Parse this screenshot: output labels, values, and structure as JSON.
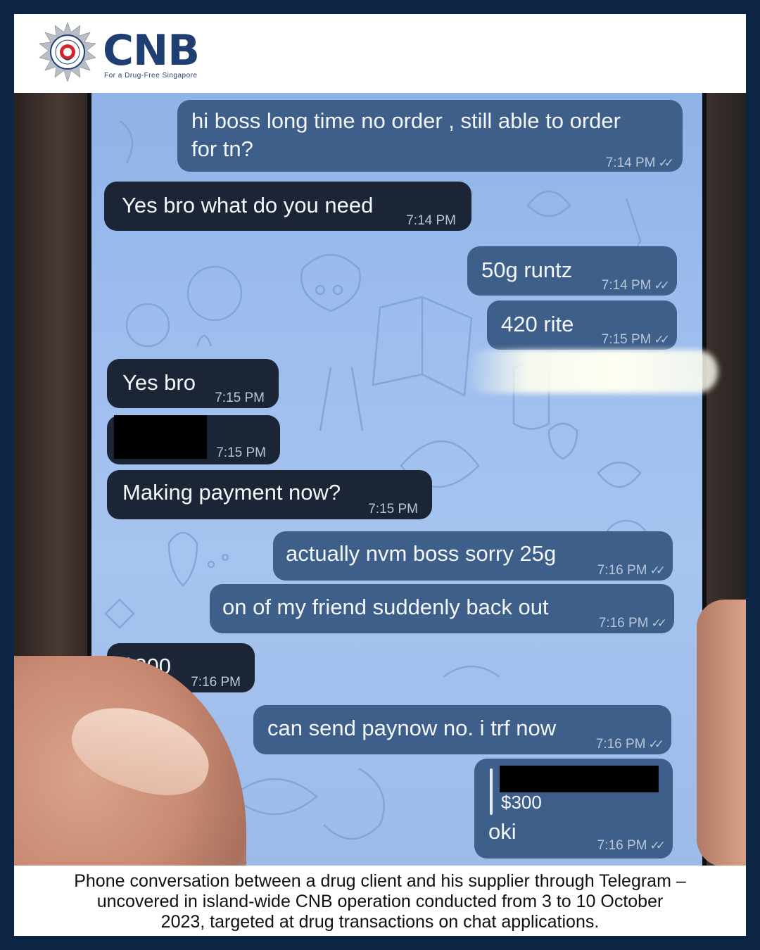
{
  "header": {
    "brand": "CNB",
    "tagline": "For a Drug-Free Singapore",
    "crest_text": "CENTRAL NARCOTICS BUREAU SINGAPORE"
  },
  "chat": {
    "messages": [
      {
        "side": "out",
        "text_lines": [
          "hi boss long time no order , still able to order",
          "for tn?"
        ],
        "time": "7:14 PM",
        "status": "read-double-check"
      },
      {
        "side": "in",
        "text": "Yes bro what do you need",
        "time": "7:14 PM"
      },
      {
        "side": "out",
        "text": "50g runtz",
        "time": "7:14 PM",
        "status": "read-double-check"
      },
      {
        "side": "out",
        "text": "420 rite",
        "time": "7:15 PM",
        "status": "read-double-check"
      },
      {
        "side": "in",
        "text": "Yes bro",
        "time": "7:15 PM"
      },
      {
        "side": "in",
        "text": "",
        "redacted": true,
        "time": "7:15 PM"
      },
      {
        "side": "in",
        "text": "Making payment now?",
        "time": "7:15 PM"
      },
      {
        "side": "out",
        "text": "actually nvm boss sorry 25g",
        "time": "7:16 PM",
        "status": "read-double-check"
      },
      {
        "side": "out",
        "text": "on of my friend suddenly back out",
        "time": "7:16 PM",
        "status": "read-double-check"
      },
      {
        "side": "in",
        "text": "$300",
        "time": "7:16 PM"
      },
      {
        "side": "out",
        "text": "can send paynow no. i trf now",
        "time": "7:16 PM",
        "status": "read-double-check"
      },
      {
        "side": "out",
        "reply_quote": "$300",
        "reply_sender_redacted": true,
        "text": "oki",
        "time": "7:16 PM",
        "status": "read-double-check"
      }
    ]
  },
  "caption": {
    "lines": [
      "Phone conversation between a drug client and his supplier through Telegram –",
      "uncovered in island-wide CNB operation conducted from 3 to 10 October",
      "2023, targeted at drug transactions on chat applications."
    ]
  },
  "colors": {
    "border": "#0d2545",
    "brand": "#1f3f73",
    "incoming_bubble": "#1c2535",
    "outgoing_bubble": "#3d5f8a",
    "chat_background": "#9dbdee"
  }
}
